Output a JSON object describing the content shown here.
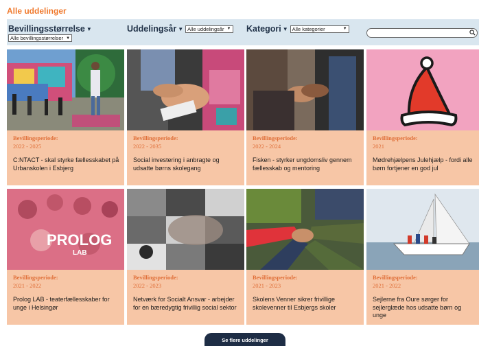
{
  "page": {
    "title": "Alle uddelinger"
  },
  "filters": {
    "grant_size": {
      "label": "Bevillingsstørrelse",
      "selected": "Alle bevillingsstørrelser"
    },
    "year": {
      "label": "Uddelingsår",
      "selected": "Alle uddelingsår"
    },
    "category": {
      "label": "Kategori",
      "selected": "Alle kategorier"
    },
    "search": {
      "placeholder": ""
    }
  },
  "cards": [
    {
      "period_label": "Bevillingsperiode:",
      "period": "2022 - 2025",
      "title": "C:NTACT - skal styrke fællesskabet på Urbanskolen i Esbjerg"
    },
    {
      "period_label": "Bevillingsperiode:",
      "period": "2022 - 2035",
      "title": "Social investering i anbragte og udsatte børns skolegang"
    },
    {
      "period_label": "Bevillingsperiode:",
      "period": "2022 - 2024",
      "title": "Fisken - styrker ungdomsliv gennem fællesskab og mentoring"
    },
    {
      "period_label": "Bevillingsperiode:",
      "period": "2021",
      "title": "Mødrehjælpens Julehjælp - fordi alle børn fortjener en god jul"
    },
    {
      "period_label": "Bevillingsperiode:",
      "period": "2021 - 2022",
      "title": "Prolog LAB - teaterfællesskaber for unge i Helsingør",
      "image_text": "PROLOG",
      "image_subtext": "LAB"
    },
    {
      "period_label": "Bevillingsperiode:",
      "period": "2022 - 2023",
      "title": "Netværk for Socialt Ansvar - arbejder for en bæredygtig frivillig social sektor"
    },
    {
      "period_label": "Bevillingsperiode:",
      "period": "2021 - 2023",
      "title": "Skolens Venner sikrer frivillige skolevenner til Esbjergs skoler"
    },
    {
      "period_label": "Bevillingsperiode:",
      "period": "2021 - 2022",
      "title": "Sejlerne fra Oure sørger for sejlerglæde hos udsatte børn og unge"
    }
  ],
  "actions": {
    "more_label": "Se flere uddelinger"
  },
  "colors": {
    "accent": "#f07a2e",
    "card_bg": "#f7c6a6",
    "filter_bg": "#d9e6ef",
    "button_bg": "#1e2d45"
  }
}
